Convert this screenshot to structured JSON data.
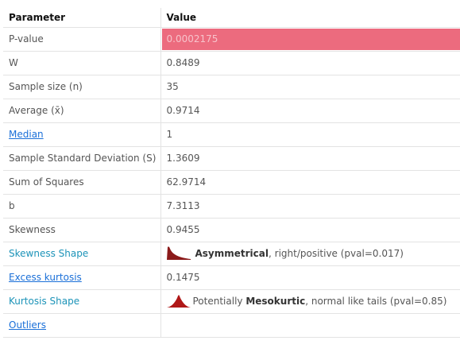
{
  "table": {
    "headers": {
      "parameter": "Parameter",
      "value": "Value"
    },
    "rows": [
      {
        "label": "P-value",
        "value": "0.0002175"
      },
      {
        "label": "W",
        "value": "0.8489"
      },
      {
        "label": "Sample size (n)",
        "value": "35"
      },
      {
        "label": "Average (x̄)",
        "value": "0.9714"
      },
      {
        "label": "Median",
        "value": "1"
      },
      {
        "label": "Sample Standard Deviation (S)",
        "value": "1.3609"
      },
      {
        "label": "Sum of Squares",
        "value": "62.9714"
      },
      {
        "label": "b",
        "value": "7.3113"
      },
      {
        "label": "Skewness",
        "value": "0.9455"
      },
      {
        "label": "Skewness Shape",
        "value_bold": "Asymmetrical",
        "value_rest": ", right/positive (pval=0.017)"
      },
      {
        "label": "Excess kurtosis",
        "value": "0.1475"
      },
      {
        "label": "Kurtosis Shape",
        "value_prefix": "Potentially ",
        "value_bold": "Mesokurtic",
        "value_rest": ", normal like tails (pval=0.85)"
      },
      {
        "label": "Outliers",
        "value": ""
      }
    ]
  },
  "colors": {
    "highlight": "#ec6b7e",
    "link": "#1a6fd8",
    "teal_label": "#1c93b8",
    "shape_icon": "#8b1a1a"
  },
  "icons": {
    "skewness_shape": "right-skewed-distribution-icon",
    "kurtosis_shape": "mesokurtic-distribution-icon"
  }
}
